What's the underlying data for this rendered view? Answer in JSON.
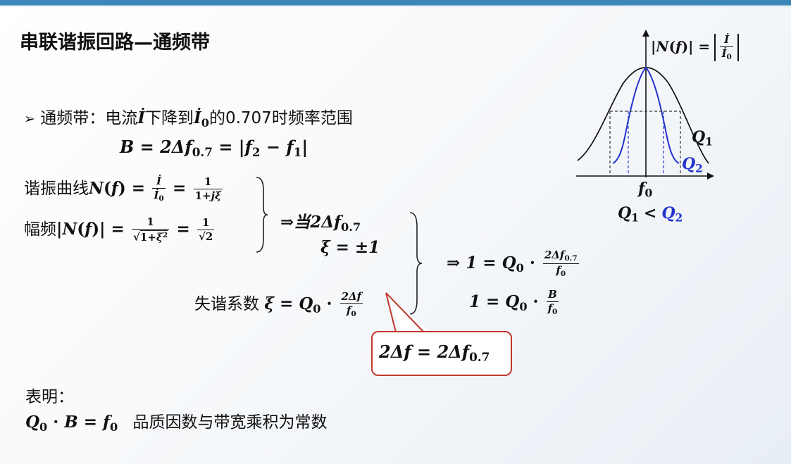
{
  "slide": {
    "title": "串联谐振回路—通频带"
  },
  "bullet": {
    "text_cn1": "通频带：电流",
    "text_cn2": "下降到",
    "text_cn3": "的0.707时频率范围"
  },
  "formula_B": "B = 2Δf",
  "formula_B_sub": "0.7",
  "formula_B_rhs": "= |f",
  "formula_B_rhs2": "− f",
  "resonance": {
    "label": "谐振曲线",
    "amplitude_label": "幅频"
  },
  "condition": {
    "when_label": "⇒当2Δf",
    "when_sub": "0.7",
    "xi_value": "ξ = ±1"
  },
  "detuning": {
    "label": "失谐系数"
  },
  "result": {
    "line1_lhs": "⇒ 1 = Q",
    "line2_lhs": "1 = Q"
  },
  "callout": {
    "lhs": "2Δf = 2Δf",
    "sub": "0.7"
  },
  "conclusion": {
    "label": "表明：",
    "statement": "品质因数与带宽乘积为常数"
  },
  "graph": {
    "title_lhs": "|N(f)| =",
    "q1_label": "Q",
    "q2_label": "Q",
    "f0_label": "f",
    "comparison": "<",
    "curve_colors": {
      "q1": "#111111",
      "q2": "#2233cc"
    }
  }
}
